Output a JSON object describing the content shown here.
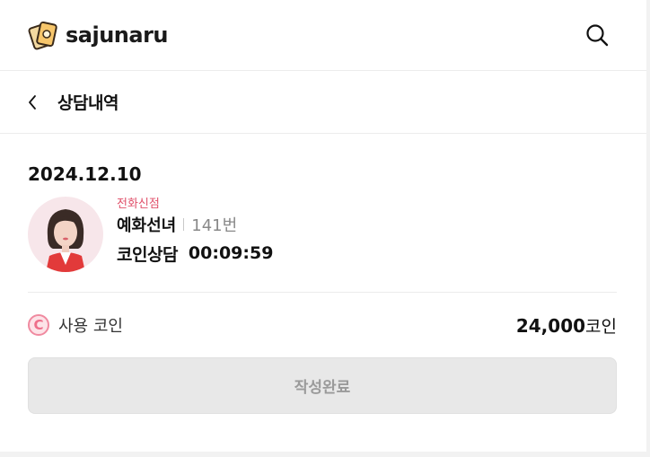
{
  "brand": {
    "name": "sajunaru"
  },
  "icons": {
    "logo": "tarot-cards-logo-icon",
    "search": "search-icon",
    "back": "chevron-left-icon",
    "coin": "coin-icon"
  },
  "page": {
    "title": "상담내역"
  },
  "consultation": {
    "date": "2024.12.10",
    "category": "전화신점",
    "counselor_name": "예화선녀",
    "counselor_number": "141번",
    "type": "코인상담",
    "duration": "00:09:59"
  },
  "coin": {
    "symbol": "C",
    "label": "사용 코인",
    "amount": "24,000",
    "unit": "코인"
  },
  "button": {
    "label": "작성완료"
  },
  "colors": {
    "accent": "#e0506a",
    "button_bg": "#e8e8e8",
    "button_text": "#9a9a9a"
  }
}
